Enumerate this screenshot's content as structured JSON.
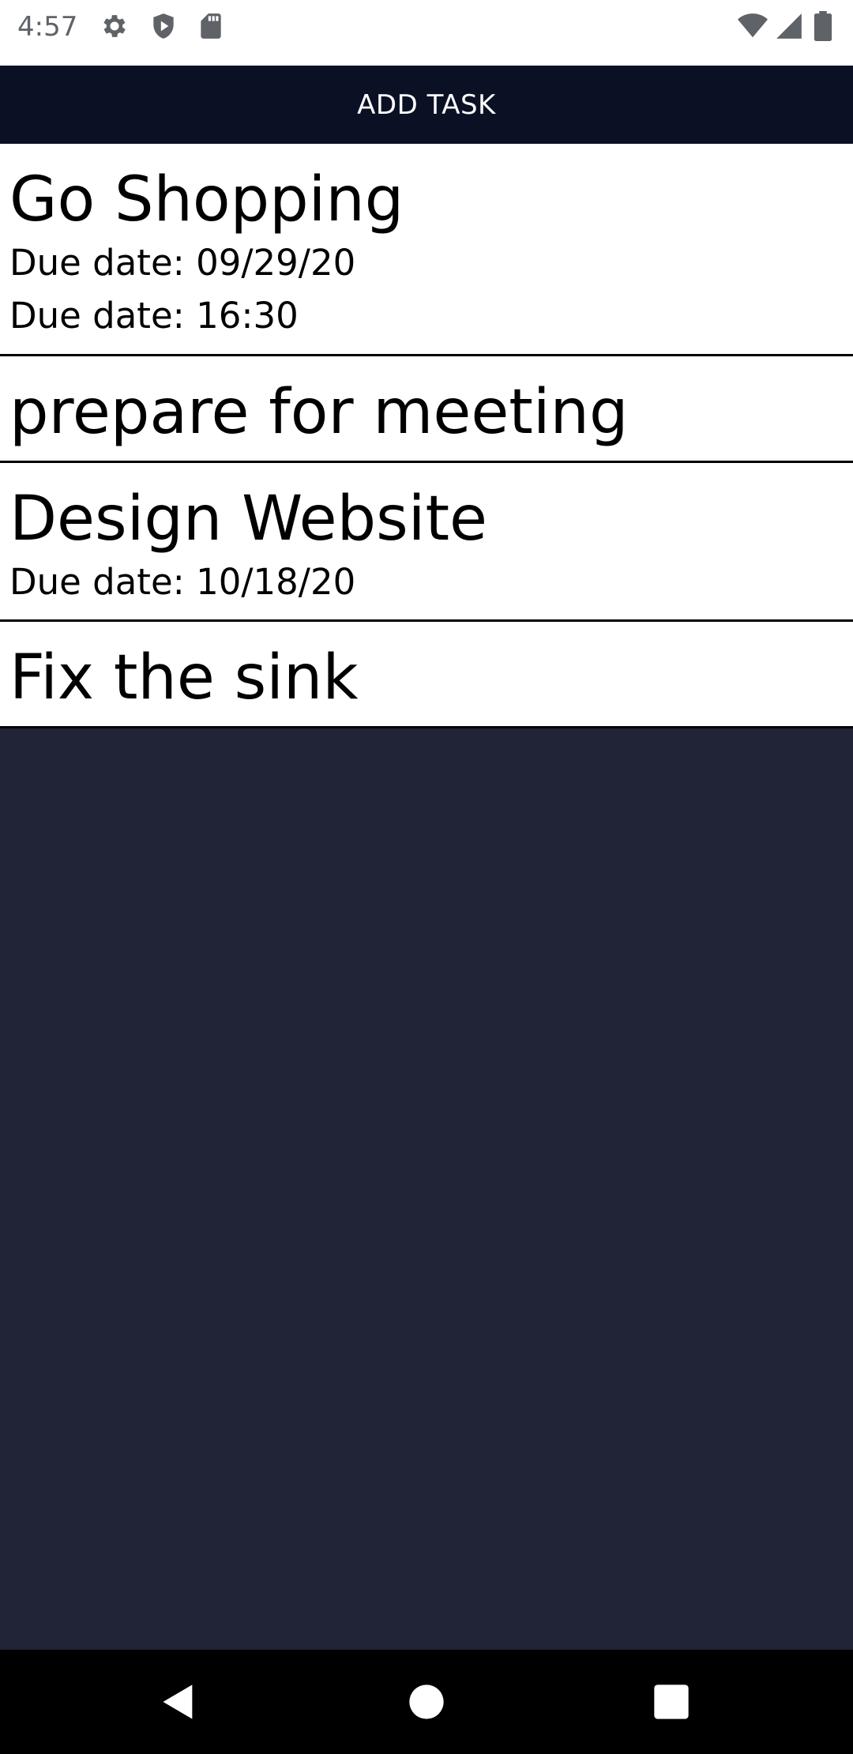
{
  "status_bar": {
    "time": "4:57",
    "left_icons": [
      "settings-icon",
      "shield-icon",
      "sd-card-icon"
    ],
    "right_icons": [
      "wifi-icon",
      "signal-icon",
      "battery-icon"
    ]
  },
  "add_task_label": "ADD TASK",
  "tasks": [
    {
      "title": "Go Shopping",
      "details": [
        "Due date: 09/29/20",
        "Due date: 16:30"
      ]
    },
    {
      "title": "prepare for meeting",
      "details": []
    },
    {
      "title": "Design Website",
      "details": [
        "Due date: 10/18/20"
      ]
    },
    {
      "title": "Fix the sink",
      "details": []
    }
  ],
  "nav_bar": {
    "buttons": [
      "back",
      "home",
      "recents"
    ]
  },
  "colors": {
    "header_bg": "#0a1124",
    "empty_bg": "#212437",
    "nav_bg": "#000000"
  }
}
